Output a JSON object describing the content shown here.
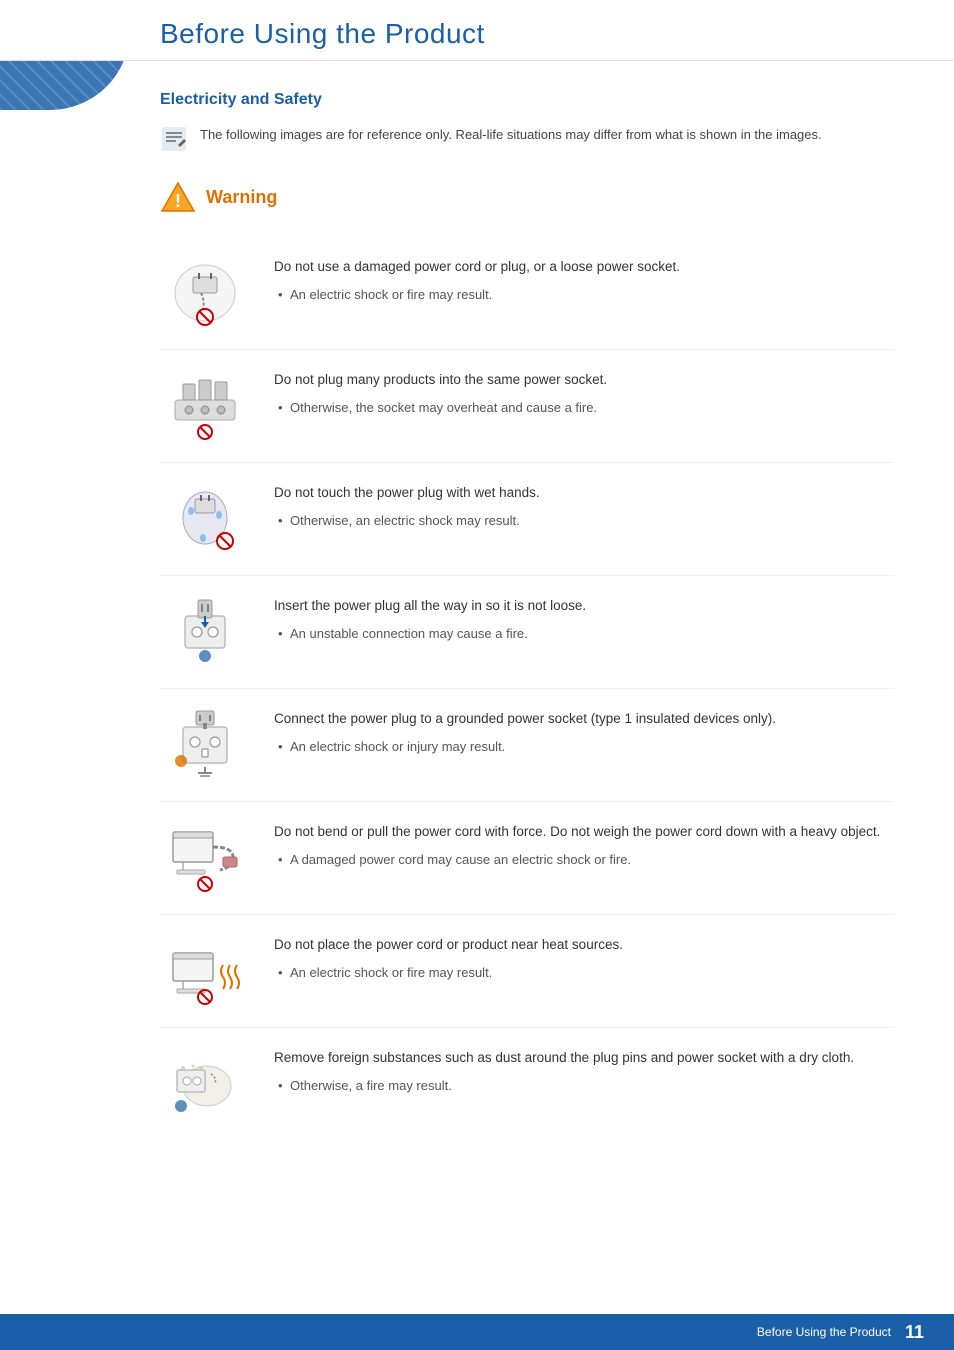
{
  "header": {
    "title": "Before Using the Product"
  },
  "section": {
    "heading": "Electricity and Safety"
  },
  "note": {
    "text": "The following images are for reference only. Real-life situations may differ from what is shown in the images."
  },
  "warning": {
    "label": "Warning"
  },
  "items": [
    {
      "main": "Do not use a damaged power cord or plug, or a loose power socket.",
      "sub": "An electric shock or fire may result."
    },
    {
      "main": "Do not plug many products into the same power socket.",
      "sub": "Otherwise, the socket may overheat and cause a fire."
    },
    {
      "main": "Do not touch the power plug with wet hands.",
      "sub": "Otherwise, an electric shock may result."
    },
    {
      "main": "Insert the power plug all the way in so it is not loose.",
      "sub": "An unstable connection may cause a fire."
    },
    {
      "main": "Connect the power plug to a grounded power socket (type 1 insulated devices only).",
      "sub": "An electric shock or injury may result."
    },
    {
      "main": "Do not bend or pull the power cord with force. Do not weigh the power cord down with a heavy object.",
      "sub": "A damaged power cord may cause an electric shock or fire."
    },
    {
      "main": "Do not place the power cord or product near heat sources.",
      "sub": "An electric shock or fire may result."
    },
    {
      "main": "Remove foreign substances such as dust around the plug pins and power socket with a dry cloth.",
      "sub": "Otherwise, a fire may result."
    }
  ],
  "footer": {
    "text": "Before Using the Product",
    "page": "11"
  }
}
